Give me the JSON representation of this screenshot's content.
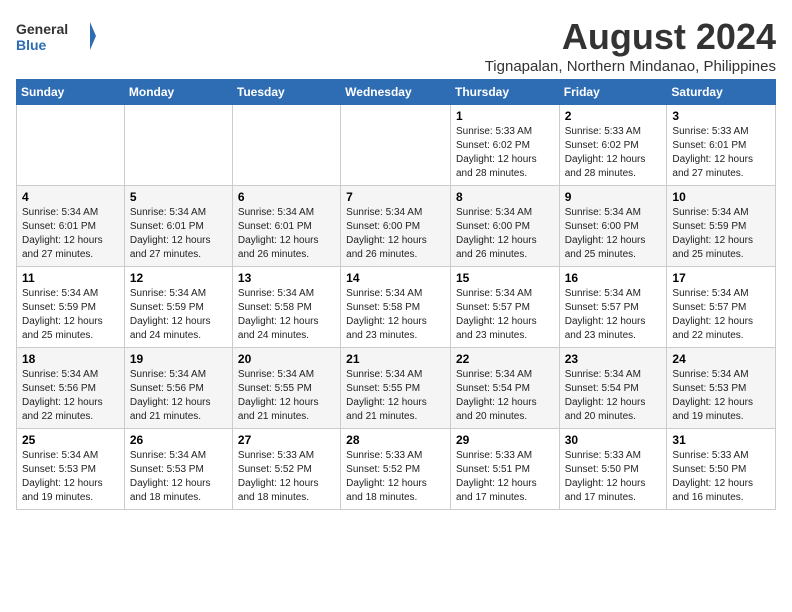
{
  "logo": {
    "line1": "General",
    "line2": "Blue"
  },
  "title": "August 2024",
  "subtitle": "Tignapalan, Northern Mindanao, Philippines",
  "days_of_week": [
    "Sunday",
    "Monday",
    "Tuesday",
    "Wednesday",
    "Thursday",
    "Friday",
    "Saturday"
  ],
  "weeks": [
    [
      {
        "day": "",
        "info": ""
      },
      {
        "day": "",
        "info": ""
      },
      {
        "day": "",
        "info": ""
      },
      {
        "day": "",
        "info": ""
      },
      {
        "day": "1",
        "info": "Sunrise: 5:33 AM\nSunset: 6:02 PM\nDaylight: 12 hours\nand 28 minutes."
      },
      {
        "day": "2",
        "info": "Sunrise: 5:33 AM\nSunset: 6:02 PM\nDaylight: 12 hours\nand 28 minutes."
      },
      {
        "day": "3",
        "info": "Sunrise: 5:33 AM\nSunset: 6:01 PM\nDaylight: 12 hours\nand 27 minutes."
      }
    ],
    [
      {
        "day": "4",
        "info": "Sunrise: 5:34 AM\nSunset: 6:01 PM\nDaylight: 12 hours\nand 27 minutes."
      },
      {
        "day": "5",
        "info": "Sunrise: 5:34 AM\nSunset: 6:01 PM\nDaylight: 12 hours\nand 27 minutes."
      },
      {
        "day": "6",
        "info": "Sunrise: 5:34 AM\nSunset: 6:01 PM\nDaylight: 12 hours\nand 26 minutes."
      },
      {
        "day": "7",
        "info": "Sunrise: 5:34 AM\nSunset: 6:00 PM\nDaylight: 12 hours\nand 26 minutes."
      },
      {
        "day": "8",
        "info": "Sunrise: 5:34 AM\nSunset: 6:00 PM\nDaylight: 12 hours\nand 26 minutes."
      },
      {
        "day": "9",
        "info": "Sunrise: 5:34 AM\nSunset: 6:00 PM\nDaylight: 12 hours\nand 25 minutes."
      },
      {
        "day": "10",
        "info": "Sunrise: 5:34 AM\nSunset: 5:59 PM\nDaylight: 12 hours\nand 25 minutes."
      }
    ],
    [
      {
        "day": "11",
        "info": "Sunrise: 5:34 AM\nSunset: 5:59 PM\nDaylight: 12 hours\nand 25 minutes."
      },
      {
        "day": "12",
        "info": "Sunrise: 5:34 AM\nSunset: 5:59 PM\nDaylight: 12 hours\nand 24 minutes."
      },
      {
        "day": "13",
        "info": "Sunrise: 5:34 AM\nSunset: 5:58 PM\nDaylight: 12 hours\nand 24 minutes."
      },
      {
        "day": "14",
        "info": "Sunrise: 5:34 AM\nSunset: 5:58 PM\nDaylight: 12 hours\nand 23 minutes."
      },
      {
        "day": "15",
        "info": "Sunrise: 5:34 AM\nSunset: 5:57 PM\nDaylight: 12 hours\nand 23 minutes."
      },
      {
        "day": "16",
        "info": "Sunrise: 5:34 AM\nSunset: 5:57 PM\nDaylight: 12 hours\nand 23 minutes."
      },
      {
        "day": "17",
        "info": "Sunrise: 5:34 AM\nSunset: 5:57 PM\nDaylight: 12 hours\nand 22 minutes."
      }
    ],
    [
      {
        "day": "18",
        "info": "Sunrise: 5:34 AM\nSunset: 5:56 PM\nDaylight: 12 hours\nand 22 minutes."
      },
      {
        "day": "19",
        "info": "Sunrise: 5:34 AM\nSunset: 5:56 PM\nDaylight: 12 hours\nand 21 minutes."
      },
      {
        "day": "20",
        "info": "Sunrise: 5:34 AM\nSunset: 5:55 PM\nDaylight: 12 hours\nand 21 minutes."
      },
      {
        "day": "21",
        "info": "Sunrise: 5:34 AM\nSunset: 5:55 PM\nDaylight: 12 hours\nand 21 minutes."
      },
      {
        "day": "22",
        "info": "Sunrise: 5:34 AM\nSunset: 5:54 PM\nDaylight: 12 hours\nand 20 minutes."
      },
      {
        "day": "23",
        "info": "Sunrise: 5:34 AM\nSunset: 5:54 PM\nDaylight: 12 hours\nand 20 minutes."
      },
      {
        "day": "24",
        "info": "Sunrise: 5:34 AM\nSunset: 5:53 PM\nDaylight: 12 hours\nand 19 minutes."
      }
    ],
    [
      {
        "day": "25",
        "info": "Sunrise: 5:34 AM\nSunset: 5:53 PM\nDaylight: 12 hours\nand 19 minutes."
      },
      {
        "day": "26",
        "info": "Sunrise: 5:34 AM\nSunset: 5:53 PM\nDaylight: 12 hours\nand 18 minutes."
      },
      {
        "day": "27",
        "info": "Sunrise: 5:33 AM\nSunset: 5:52 PM\nDaylight: 12 hours\nand 18 minutes."
      },
      {
        "day": "28",
        "info": "Sunrise: 5:33 AM\nSunset: 5:52 PM\nDaylight: 12 hours\nand 18 minutes."
      },
      {
        "day": "29",
        "info": "Sunrise: 5:33 AM\nSunset: 5:51 PM\nDaylight: 12 hours\nand 17 minutes."
      },
      {
        "day": "30",
        "info": "Sunrise: 5:33 AM\nSunset: 5:50 PM\nDaylight: 12 hours\nand 17 minutes."
      },
      {
        "day": "31",
        "info": "Sunrise: 5:33 AM\nSunset: 5:50 PM\nDaylight: 12 hours\nand 16 minutes."
      }
    ]
  ]
}
